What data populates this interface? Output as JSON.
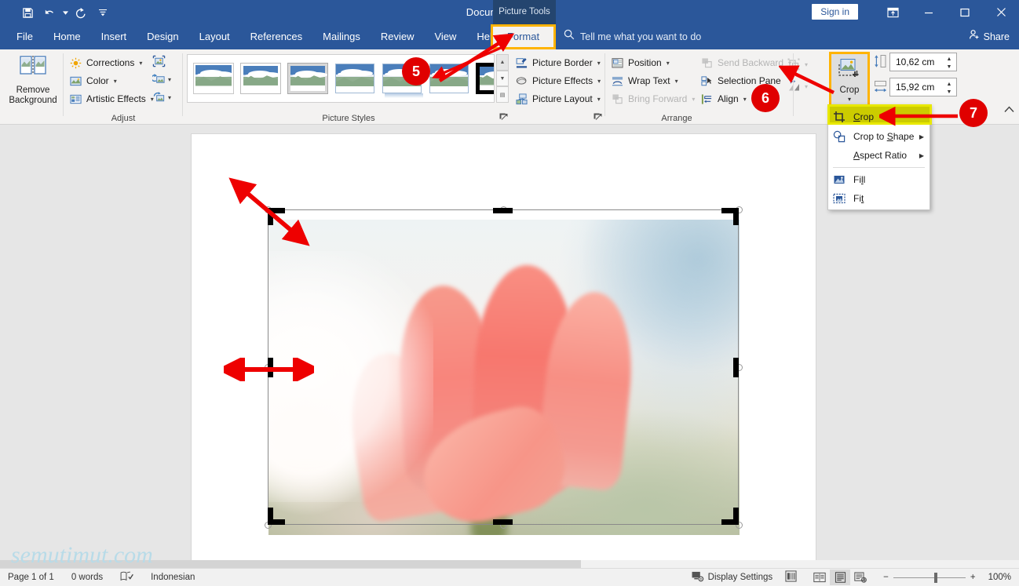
{
  "window": {
    "title": "Document1  -  Word",
    "context_tab_label": "Picture Tools",
    "sign_in": "Sign in",
    "quick_access": [
      "save-icon",
      "undo-icon",
      "redo-icon",
      "customize-qat-icon"
    ],
    "caption_buttons": [
      "ribbon-display-options-icon",
      "minimize-icon",
      "maximize-icon",
      "close-icon"
    ]
  },
  "tabs": [
    {
      "label": "File"
    },
    {
      "label": "Home"
    },
    {
      "label": "Insert"
    },
    {
      "label": "Design"
    },
    {
      "label": "Layout"
    },
    {
      "label": "References"
    },
    {
      "label": "Mailings"
    },
    {
      "label": "Review"
    },
    {
      "label": "View"
    },
    {
      "label": "Help"
    }
  ],
  "format_tab": {
    "label": "Format",
    "highlight_color": "#ffb300"
  },
  "tell_me": {
    "placeholder": "Tell me what you want to do",
    "icon": "search-icon"
  },
  "share": {
    "label": "Share",
    "icon": "share-person-icon"
  },
  "ribbon": {
    "remove_background": {
      "line1": "Remove",
      "line2": "Background",
      "icon": "remove-background-icon"
    },
    "adjust": {
      "group_label": "Adjust",
      "items": [
        {
          "label": "Corrections",
          "icon": "corrections-sun-icon",
          "has_caret": true
        },
        {
          "label": "Color",
          "icon": "color-picture-icon",
          "has_caret": true
        },
        {
          "label": "Artistic Effects",
          "icon": "artistic-effects-icon",
          "has_caret": true
        }
      ],
      "small_buttons": [
        {
          "icon": "compress-pictures-icon",
          "has_caret": false
        },
        {
          "icon": "change-picture-icon",
          "has_caret": true
        },
        {
          "icon": "reset-picture-icon",
          "has_caret": true
        }
      ]
    },
    "picture_styles": {
      "group_label": "Picture Styles",
      "thumbnails": 7,
      "selected_index": 6,
      "scroll_buttons": [
        "scroll-up",
        "scroll-down",
        "more-styles"
      ],
      "dialog_launcher": "picture-styles-dialog-launcher"
    },
    "picture_buttons": [
      {
        "label": "Picture Border",
        "icon": "picture-border-icon",
        "has_caret": true
      },
      {
        "label": "Picture Effects",
        "icon": "picture-effects-icon",
        "has_caret": true
      },
      {
        "label": "Picture Layout",
        "icon": "picture-layout-icon",
        "has_caret": true
      }
    ],
    "arrange": {
      "group_label": "Arrange",
      "col1": [
        {
          "label": "Position",
          "icon": "position-icon",
          "has_caret": true,
          "disabled": false
        },
        {
          "label": "Wrap Text",
          "icon": "wrap-text-icon",
          "has_caret": true,
          "disabled": false
        },
        {
          "label": "Bring Forward",
          "icon": "bring-forward-icon",
          "has_caret": true,
          "disabled": true
        }
      ],
      "col2": [
        {
          "label": "Send Backward",
          "icon": "send-backward-icon",
          "has_caret": true,
          "disabled": true
        },
        {
          "label": "Selection Pane",
          "icon": "selection-pane-icon",
          "has_caret": false,
          "disabled": false
        },
        {
          "label": "Align",
          "icon": "align-icon",
          "has_caret": true,
          "disabled": false
        }
      ],
      "col3": [
        {
          "icon": "group-objects-icon",
          "has_caret": true,
          "disabled": true
        },
        {
          "icon": "rotate-objects-icon",
          "has_caret": true,
          "disabled": true
        }
      ]
    },
    "size": {
      "crop_button": {
        "label": "Crop",
        "icon": "crop-icon",
        "has_caret": true,
        "highlight_color": "#ffb300"
      },
      "height": {
        "value": "10,62 cm",
        "icon": "shape-height-icon"
      },
      "width": {
        "value": "15,92 cm",
        "icon": "shape-width-icon"
      }
    },
    "collapse_ribbon_icon": "collapse-ribbon-icon"
  },
  "crop_menu": {
    "highlight_color": "#cccc00",
    "items": [
      {
        "label": "Crop",
        "icon": "crop-icon",
        "submenu": false,
        "highlighted": true
      },
      {
        "label": "Crop to Shape",
        "icon": "crop-to-shape-icon",
        "submenu": true,
        "highlighted": false
      },
      {
        "label": "Aspect Ratio",
        "icon": "",
        "submenu": true,
        "highlighted": false
      },
      {
        "label": "Fill",
        "icon": "fill-icon",
        "submenu": false,
        "highlighted": false
      },
      {
        "label": "Fit",
        "icon": "fit-icon",
        "submenu": false,
        "highlighted": false
      }
    ]
  },
  "callouts": [
    {
      "number": "5",
      "target": "picture-styles-gallery"
    },
    {
      "number": "6",
      "target": "crop-ribbon-button"
    },
    {
      "number": "7",
      "target": "crop-menu-item"
    }
  ],
  "document": {
    "image_alt": "pink tulip photo",
    "selection": "picture-selected-with-crop-handles",
    "annotations": [
      "diagonal-resize-arrow",
      "horizontal-resize-arrow"
    ]
  },
  "watermark": {
    "text": "semutimut.com",
    "color": "#b8dbe8"
  },
  "status_bar": {
    "page": "Page 1 of 1",
    "words": "0 words",
    "proofing_icon": "proofing-errors-icon",
    "language": "Indonesian",
    "display_settings": {
      "label": "Display Settings",
      "icon": "display-settings-icon"
    },
    "accessibility_icon": "accessibility-checker-icon",
    "views": [
      {
        "name": "read-mode",
        "icon": "read-mode-icon",
        "active": false
      },
      {
        "name": "print-layout",
        "icon": "print-layout-icon",
        "active": true
      },
      {
        "name": "web-layout",
        "icon": "web-layout-icon",
        "active": false
      }
    ],
    "zoom": {
      "out": "−",
      "in": "+",
      "level": "100%",
      "value": 100
    }
  }
}
